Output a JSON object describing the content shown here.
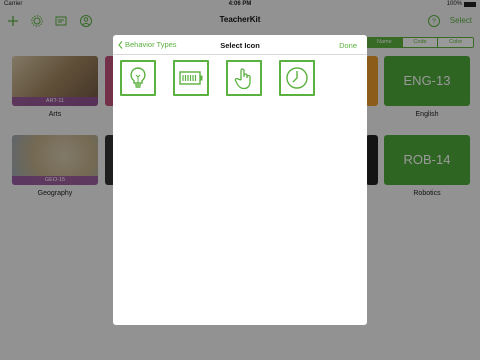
{
  "status_bar": {
    "carrier": "Carrier",
    "time": "4:06 PM",
    "battery": "100%"
  },
  "navbar": {
    "title": "TeacherKit",
    "select_label": "Select",
    "icons": [
      "add-icon",
      "gear-icon",
      "report-icon",
      "profile-icon",
      "help-icon"
    ]
  },
  "sort_control": {
    "options": [
      "Name",
      "Code",
      "Color"
    ],
    "selected": "Name"
  },
  "classes": [
    {
      "name": "Arts",
      "code": "ART-11",
      "color": "#8e5aa6"
    },
    {
      "name": "English",
      "code": "ENG-13",
      "color": "#4ea83a"
    },
    {
      "name": "Geography",
      "code": "GEO-15",
      "color": "#8e5aa6"
    },
    {
      "name": "Robotics",
      "code": "ROB-14",
      "color": "#4ea83a"
    }
  ],
  "modal": {
    "back_label": "Behavior Types",
    "title": "Select Icon",
    "done_label": "Done",
    "icons": [
      "lightbulb-icon",
      "battery-icon",
      "hand-icon",
      "clock-icon"
    ]
  },
  "colors": {
    "accent": "#5bb13f"
  }
}
